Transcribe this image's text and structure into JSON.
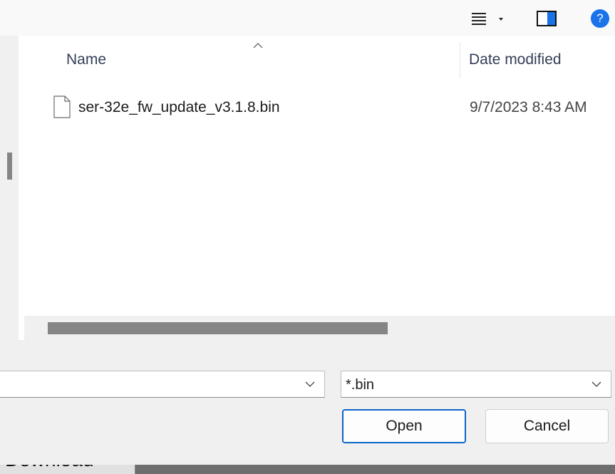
{
  "toolbar": {
    "view_icon": "view-options-icon",
    "dropdown_icon": "caret-down-icon",
    "preview_icon": "preview-pane-icon",
    "help_label": "?"
  },
  "file_list": {
    "columns": {
      "name": "Name",
      "date_modified": "Date modified"
    },
    "files": [
      {
        "name": "ser-32e_fw_update_v3.1.8.bin",
        "date_modified": "9/7/2023 8:43 AM",
        "icon": "file-icon"
      }
    ]
  },
  "bottom": {
    "filename_value": "",
    "file_type_value": "*.bin",
    "open_label": "Open",
    "cancel_label": "Cancel"
  },
  "background_window": {
    "button_label": "Download"
  },
  "colors": {
    "accent": "#0a64c8",
    "help": "#1a73e8",
    "scroll_thumb": "#858585"
  }
}
